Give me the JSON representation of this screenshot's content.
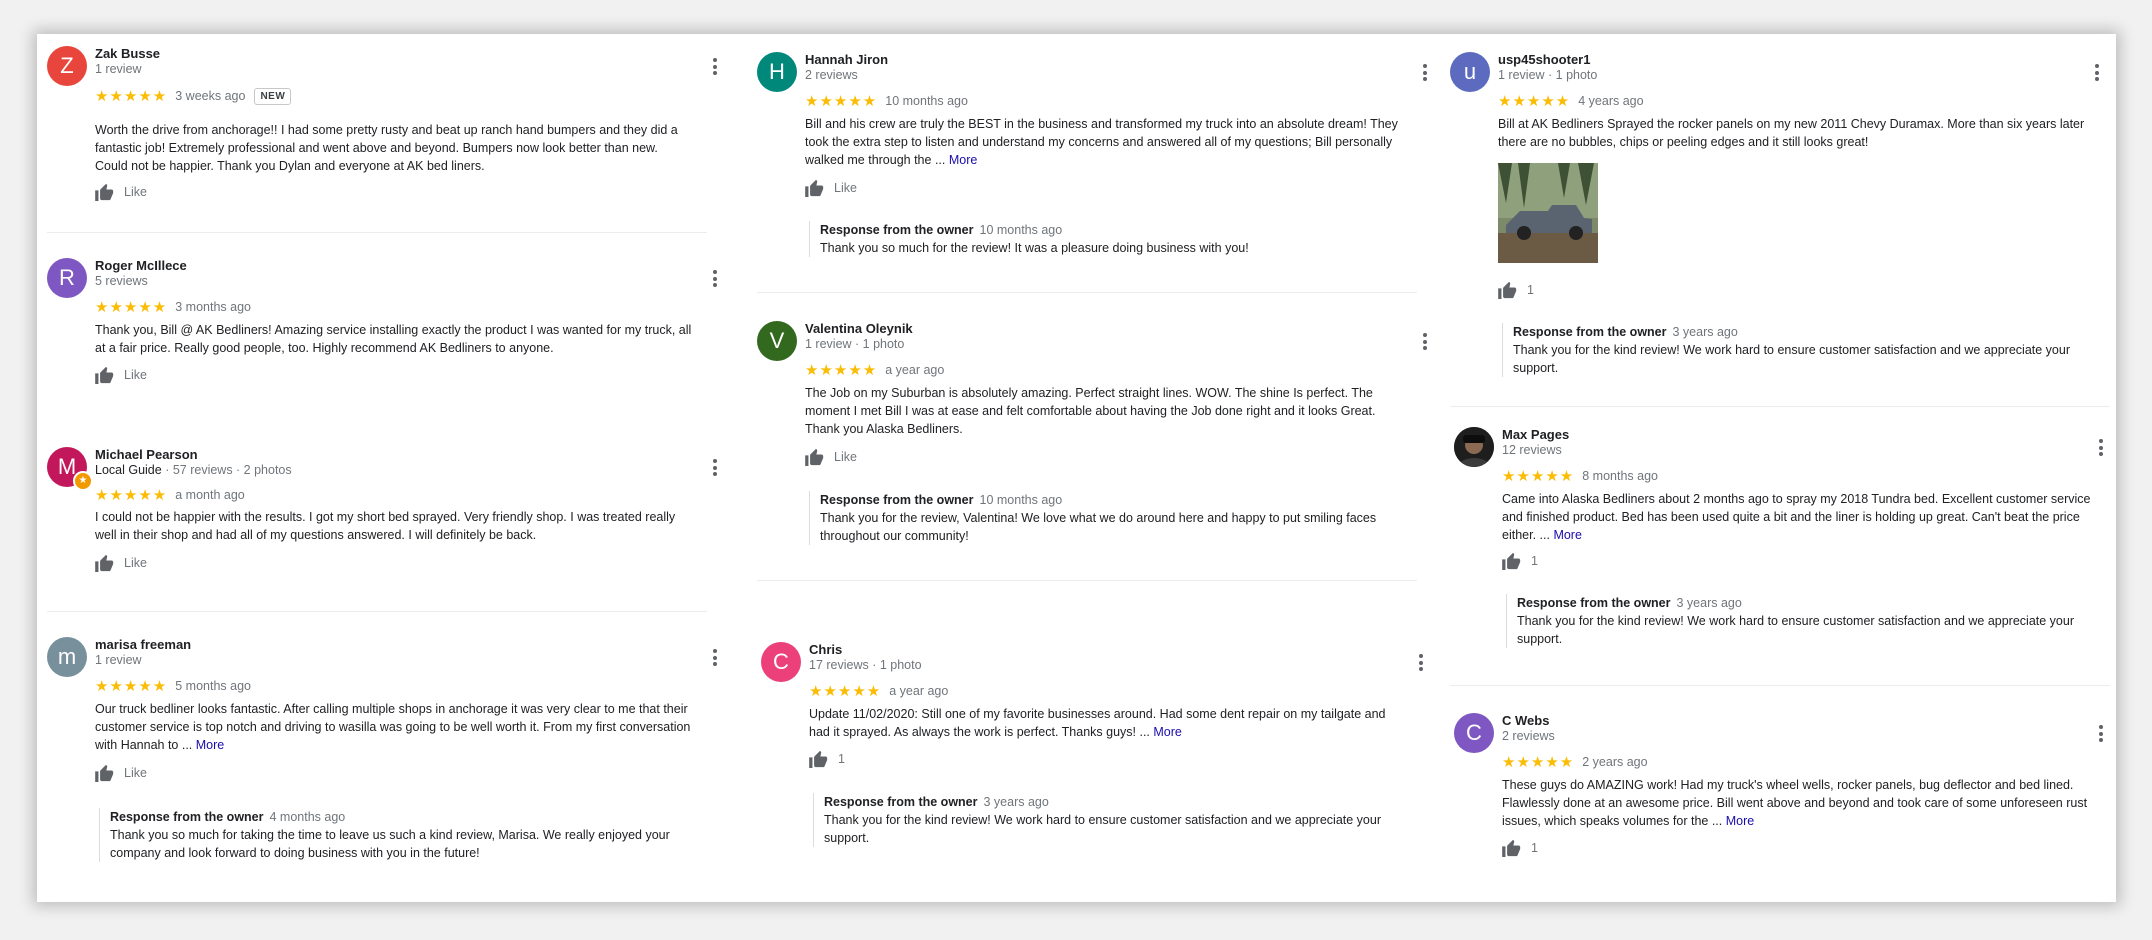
{
  "like_label": "Like",
  "more_label": "More",
  "owner_label": "Response from the owner",
  "stars": "★★★★★",
  "colors": {
    "star": "#fbbc04",
    "link": "#1a0dab",
    "muted": "#70757a"
  },
  "reviews": [
    {
      "name": "Zak Busse",
      "initial": "Z",
      "avatar_color": "#e8453c",
      "meta": "1 review",
      "time": "3 weeks ago",
      "badge": "NEW",
      "text": "Worth the drive from anchorage!! I had some pretty rusty and beat up ranch hand bumpers and they did a fantastic job! Extremely professional and went above and beyond. Bumpers now look better than new. Could not be happier. Thank you Dylan and everyone at AK bed liners."
    },
    {
      "name": "Roger McIllece",
      "initial": "R",
      "avatar_color": "#7e57c2",
      "meta": "5 reviews",
      "time": "3 months ago",
      "text": "Thank you, Bill @ AK Bedliners!  Amazing service installing exactly the product I was wanted for my truck, all at a fair price. Really good people, too. Highly recommend AK Bedliners to anyone."
    },
    {
      "name": "Michael Pearson",
      "initial": "M",
      "avatar_color": "#c2185b",
      "guide": "Local Guide",
      "meta": " · 57 reviews · 2 photos",
      "time": "a month ago",
      "text": "I could not be happier with the results. I got my short bed sprayed. Very friendly shop. I was treated really well in their shop and had all of my questions answered. I will definitely be back."
    },
    {
      "name": "marisa freeman",
      "initial": "m",
      "avatar_color": "#78909c",
      "meta": "1 review",
      "time": "5 months ago",
      "text": "Our truck bedliner looks fantastic. After calling multiple shops in anchorage it was very clear to me that their customer service is top notch and driving to wasilla was going to be well worth it. From my first conversation with Hannah to ...",
      "owner_time": "4 months ago",
      "owner_text": "Thank you so much for taking the time to leave us such a kind review, Marisa. We really enjoyed your company and look forward to doing business with you in the future!"
    },
    {
      "name": "Hannah Jiron",
      "initial": "H",
      "avatar_color": "#00897b",
      "meta": "2 reviews",
      "time": "10 months ago",
      "text": "Bill and his crew are truly the BEST in the business and transformed my truck into an absolute dream! They took the extra step to listen and understand my concerns and answered all of my questions; Bill personally walked me through the ...",
      "owner_time": "10 months ago",
      "owner_text": "Thank you so much for the review! It was a pleasure doing business with you!"
    },
    {
      "name": "Valentina Oleynik",
      "initial": "V",
      "avatar_color": "#33691e",
      "meta": "1 review · 1 photo",
      "time": "a year ago",
      "text": "The Job on my Suburban is absolutely amazing.  Perfect straight lines. WOW.  The shine Is perfect.  The moment I met Bill I was at ease and felt comfortable about having the Job done right and it looks Great. Thank you Alaska Bedliners.",
      "owner_time": "10 months ago",
      "owner_text": "Thank you for the review, Valentina! We love what we do around here and happy to put smiling faces throughout our community!"
    },
    {
      "name": "Chris",
      "initial": "C",
      "avatar_color": "#ec407a",
      "meta": "17 reviews · 1 photo",
      "time": "a year ago",
      "text": "Update 11/02/2020: Still one of my favorite businesses around. Had some dent repair on my tailgate and had it sprayed. As always the work is perfect. Thanks guys! ...",
      "likes": "1",
      "owner_time": "3 years ago",
      "owner_text": "Thank you for the kind review! We work hard to ensure customer satisfaction and we appreciate your support."
    },
    {
      "name": "usp45shooter1",
      "initial": "u",
      "avatar_color": "#5c6bc0",
      "meta": "1 review · 1 photo",
      "time": "4 years ago",
      "text": "Bill at AK Bedliners Sprayed the rocker panels on my new 2011 Chevy Duramax. More than six years later there are no bubbles, chips or peeling edges and it still looks great!",
      "likes": "1",
      "owner_time": "3 years ago",
      "owner_text": "Thank you for the kind review! We work hard to ensure customer satisfaction and we appreciate your support."
    },
    {
      "name": "Max Pages",
      "initial": "",
      "meta": "12 reviews",
      "time": "8 months ago",
      "text": "Came into Alaska Bedliners about 2 months ago to spray my 2018 Tundra bed. Excellent customer service and finished product. Bed has been used quite a bit and the liner is holding up great. Can't beat the price either. ...",
      "likes": "1",
      "owner_time": "3 years ago",
      "owner_text": "Thank you for the kind review! We work hard to ensure customer satisfaction and we appreciate your support."
    },
    {
      "name": "C Webs",
      "initial": "C",
      "avatar_color": "#7e57c2",
      "meta": "2 reviews",
      "time": "2 years ago",
      "text": "These guys do AMAZING work! Had my truck's wheel wells, rocker panels, bug deflector and bed lined. Flawlessly done at an awesome price. Bill went above and beyond and took care of some unforeseen rust issues, which speaks volumes for the ...",
      "likes": "1"
    }
  ]
}
